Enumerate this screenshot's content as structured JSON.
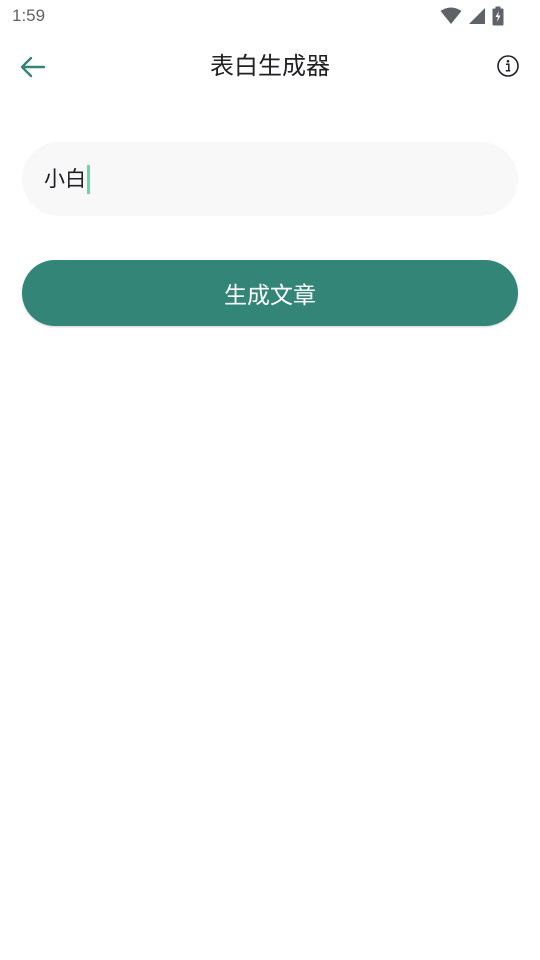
{
  "status_bar": {
    "time": "1:59",
    "icons": [
      "wifi-icon",
      "signal-icon",
      "battery-charging-icon"
    ]
  },
  "app_bar": {
    "back_icon": "arrow-left-icon",
    "title": "表白生成器",
    "info_icon": "info-circle-icon"
  },
  "form": {
    "name_input_value": "小白",
    "generate_button_label": "生成文章"
  },
  "colors": {
    "primary": "#338677",
    "caret": "#5fdba7",
    "input_bg": "#f8f8f8"
  }
}
